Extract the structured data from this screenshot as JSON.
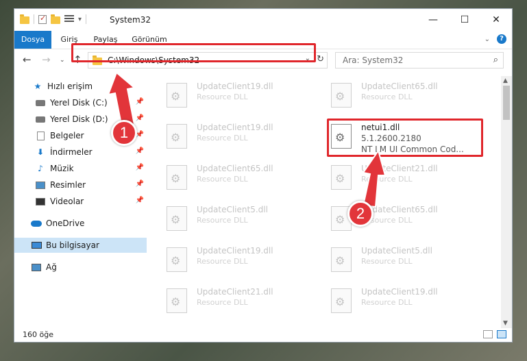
{
  "window": {
    "title": "System32"
  },
  "ribbon": {
    "tabs": [
      "Dosya",
      "Giriş",
      "Paylaş",
      "Görünüm"
    ]
  },
  "navbar": {
    "back_icon": "back-arrow",
    "forward_icon": "forward-arrow",
    "up_icon": "up-arrow",
    "address": "C:\\Windows\\System32",
    "search_placeholder": "Ara: System32"
  },
  "sidebar": {
    "items": [
      {
        "label": "Hızlı erişim",
        "icon": "star-icon"
      },
      {
        "label": "Yerel Disk (C:)",
        "icon": "drive-icon"
      },
      {
        "label": "Yerel Disk (D:)",
        "icon": "drive-icon"
      },
      {
        "label": "Belgeler",
        "icon": "documents-icon"
      },
      {
        "label": "İndirmeler",
        "icon": "downloads-icon"
      },
      {
        "label": "Müzik",
        "icon": "music-icon"
      },
      {
        "label": "Resimler",
        "icon": "pictures-icon"
      },
      {
        "label": "Videolar",
        "icon": "videos-icon"
      },
      {
        "label": "OneDrive",
        "icon": "cloud-icon"
      },
      {
        "label": "Bu bilgisayar",
        "icon": "computer-icon"
      },
      {
        "label": "Ağ",
        "icon": "network-icon"
      }
    ]
  },
  "files": [
    {
      "name": "UpdateClient19.dll",
      "type": "Resource DLL"
    },
    {
      "name": "UpdateClient65.dll",
      "type": "Resource DLL"
    },
    {
      "name": "UpdateClient19.dll",
      "type": "Resource DLL"
    },
    {
      "name": "netui1.dll",
      "version": "5.1.2600.2180",
      "description": "NT LM UI Common Cod..."
    },
    {
      "name": "UpdateClient65.dll",
      "type": "Resource DLL"
    },
    {
      "name": "UpdateClient21.dll",
      "type": "Resource DLL"
    },
    {
      "name": "UpdateClient5.dll",
      "type": "Resource DLL"
    },
    {
      "name": "UpdateClient65.dll",
      "type": "Resource DLL"
    },
    {
      "name": "UpdateClient19.dll",
      "type": "Resource DLL"
    },
    {
      "name": "UpdateClient5.dll",
      "type": "Resource DLL"
    },
    {
      "name": "UpdateClient21.dll",
      "type": "Resource DLL"
    },
    {
      "name": "UpdateClient19.dll",
      "type": "Resource DLL"
    }
  ],
  "status": {
    "count": "160 öğe"
  },
  "annotations": {
    "marker1": "1",
    "marker2": "2"
  },
  "colors": {
    "accent": "#1979ca",
    "highlight": "#e0262b"
  }
}
